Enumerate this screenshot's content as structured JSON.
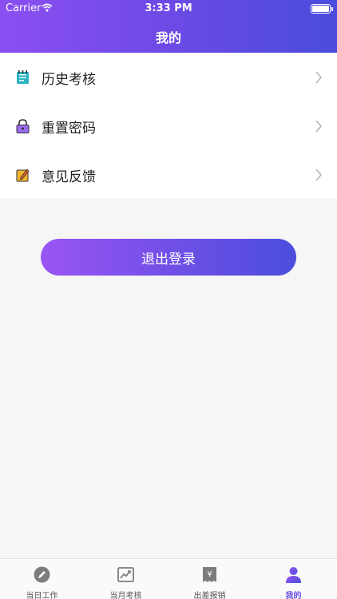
{
  "status_bar": {
    "carrier": "Carrier",
    "time": "3:33 PM"
  },
  "header": {
    "title": "我的"
  },
  "menu": {
    "items": [
      {
        "label": "历史考核",
        "icon": "notebook-icon"
      },
      {
        "label": "重置密码",
        "icon": "lock-icon"
      },
      {
        "label": "意见反馈",
        "icon": "edit-note-icon"
      }
    ]
  },
  "logout": {
    "label": "退出登录"
  },
  "tabbar": {
    "active_index": 3,
    "tabs": [
      {
        "label": "当日工作",
        "icon": "pencil-icon"
      },
      {
        "label": "当月考核",
        "icon": "chart-icon"
      },
      {
        "label": "出差报销",
        "icon": "receipt-icon"
      },
      {
        "label": "我的",
        "icon": "user-icon"
      }
    ]
  },
  "colors": {
    "accent": "#6a4de2",
    "gradient_start": "#8b4ff0",
    "gradient_end": "#4a4cdc",
    "background": "#f6f6f6"
  }
}
